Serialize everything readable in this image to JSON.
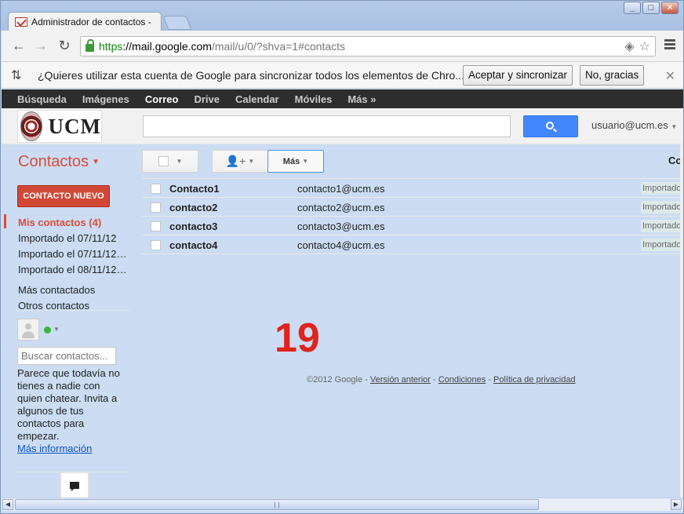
{
  "browser": {
    "tab_title": "Administrador de contactos -",
    "url_scheme": "https",
    "url_host": "://mail.google.com",
    "url_path": "/mail/u/0/?shva=1#contacts",
    "window_buttons": [
      "_",
      "□",
      "✕"
    ]
  },
  "infobar": {
    "message": "¿Quieres utilizar esta cuenta de Google para sincronizar todos los elementos de Chro...",
    "accept_label": "Aceptar y sincronizar",
    "decline_label": "No, gracias"
  },
  "gbar": {
    "items": [
      "Búsqueda",
      "Imágenes",
      "Correo",
      "Drive",
      "Calendar",
      "Móviles",
      "Más »"
    ],
    "active": "Correo"
  },
  "header": {
    "logo_text": "UCM",
    "account": "usuario@ucm.es"
  },
  "app": {
    "title": "Contactos",
    "more_label": "Más",
    "cut_label": "Co"
  },
  "sidebar": {
    "new_contact": "CONTACTO NUEVO",
    "groups": [
      "Mis contactos (4)",
      "Importado el 07/11/12",
      "Importado el 07/11/12…",
      "Importado el 08/11/12…"
    ],
    "other": [
      "Más contactados",
      "Otros contactos"
    ]
  },
  "chat": {
    "search_placeholder": "Buscar contactos...",
    "help_text": "Parece que todavía no tienes a nadie con quien chatear. Invita a algunos de tus contactos para empezar.",
    "more_info": "Más información"
  },
  "contacts": [
    {
      "name": "Contacto1",
      "email": "contacto1@ucm.es",
      "label": "Importado"
    },
    {
      "name": "contacto2",
      "email": "contacto2@ucm.es",
      "label": "Importado"
    },
    {
      "name": "contacto3",
      "email": "contacto3@ucm.es",
      "label": "Importado"
    },
    {
      "name": "contacto4",
      "email": "contacto4@ucm.es",
      "label": "Importado"
    }
  ],
  "overlay_number": "19",
  "footer": {
    "copyright": "©2012 Google",
    "links": [
      "Versión anterior",
      "Condiciones",
      "Política de privacidad"
    ]
  },
  "colors": {
    "accent_red": "#dd4b39",
    "search_blue": "#4387fd",
    "overlay_red": "#e0231c"
  }
}
